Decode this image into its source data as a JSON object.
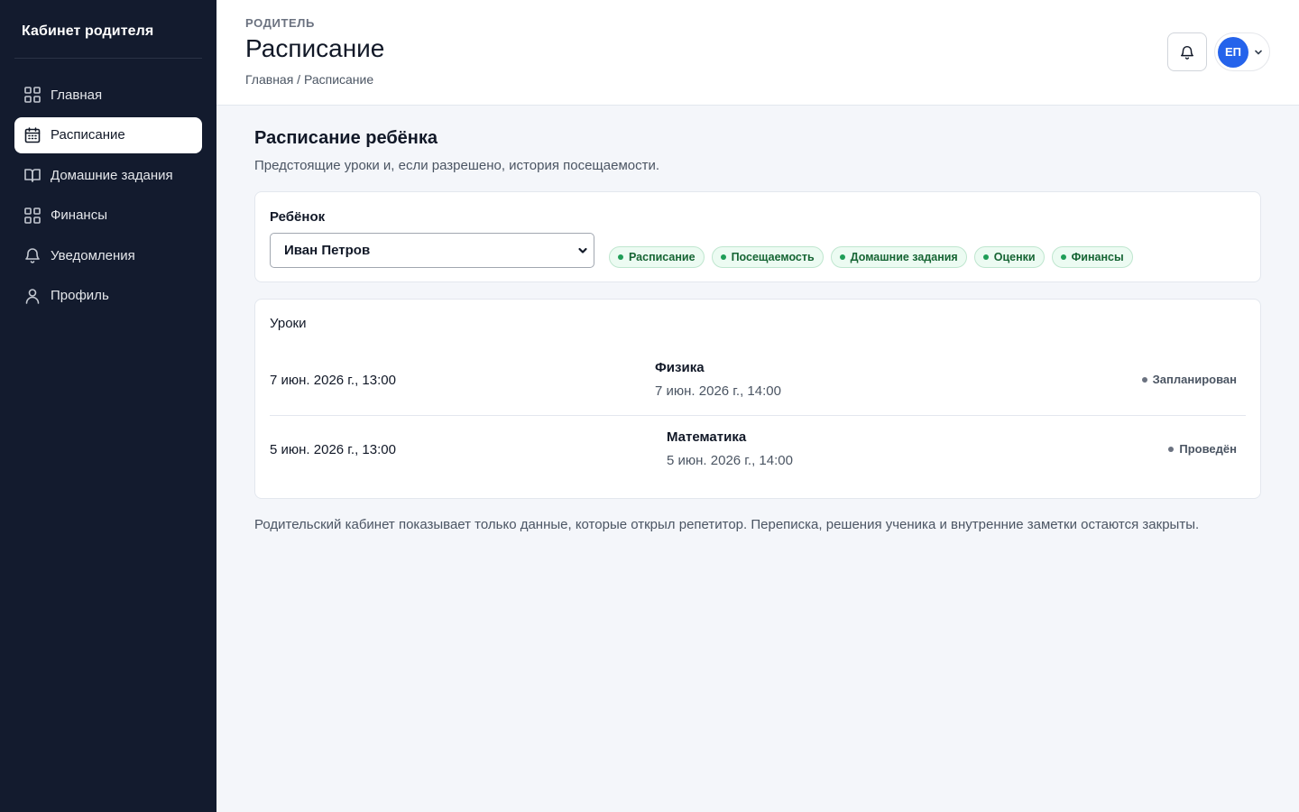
{
  "sidebar": {
    "brand": "Кабинет родителя",
    "items": [
      {
        "label": "Главная",
        "icon": "dashboard-icon"
      },
      {
        "label": "Расписание",
        "icon": "calendar-icon",
        "active": true
      },
      {
        "label": "Домашние задания",
        "icon": "book-icon"
      },
      {
        "label": "Финансы",
        "icon": "grid-icon"
      },
      {
        "label": "Уведомления",
        "icon": "bell-icon"
      },
      {
        "label": "Профиль",
        "icon": "user-icon"
      }
    ]
  },
  "header": {
    "role": "РОДИТЕЛЬ",
    "title": "Расписание",
    "breadcrumb": "Главная / Расписание",
    "avatar_initials": "ЕП"
  },
  "main": {
    "title": "Расписание ребёнка",
    "subtitle": "Предстоящие уроки и, если разрешено, история посещаемости.",
    "child_label": "Ребёнок",
    "child_selected": "Иван Петров",
    "permissions": [
      "Расписание",
      "Посещаемость",
      "Домашние задания",
      "Оценки",
      "Финансы"
    ],
    "lessons_title": "Уроки",
    "lessons": [
      {
        "start": "7 июн. 2026 г., 13:00",
        "subject": "Физика",
        "end": "7 июн. 2026 г., 14:00",
        "status": "Запланирован"
      },
      {
        "start": "5 июн. 2026 г., 13:00",
        "subject": "Математика",
        "end": "5 июн. 2026 г., 14:00",
        "status": "Проведён"
      }
    ],
    "footnote": "Родительский кабинет показывает только данные, которые открыл репетитор. Переписка, решения ученика и внутренние заметки остаются закрыты."
  },
  "colors": {
    "sidebar_bg": "#131b2e",
    "accent": "#2563eb",
    "permission_green": "#166534"
  }
}
